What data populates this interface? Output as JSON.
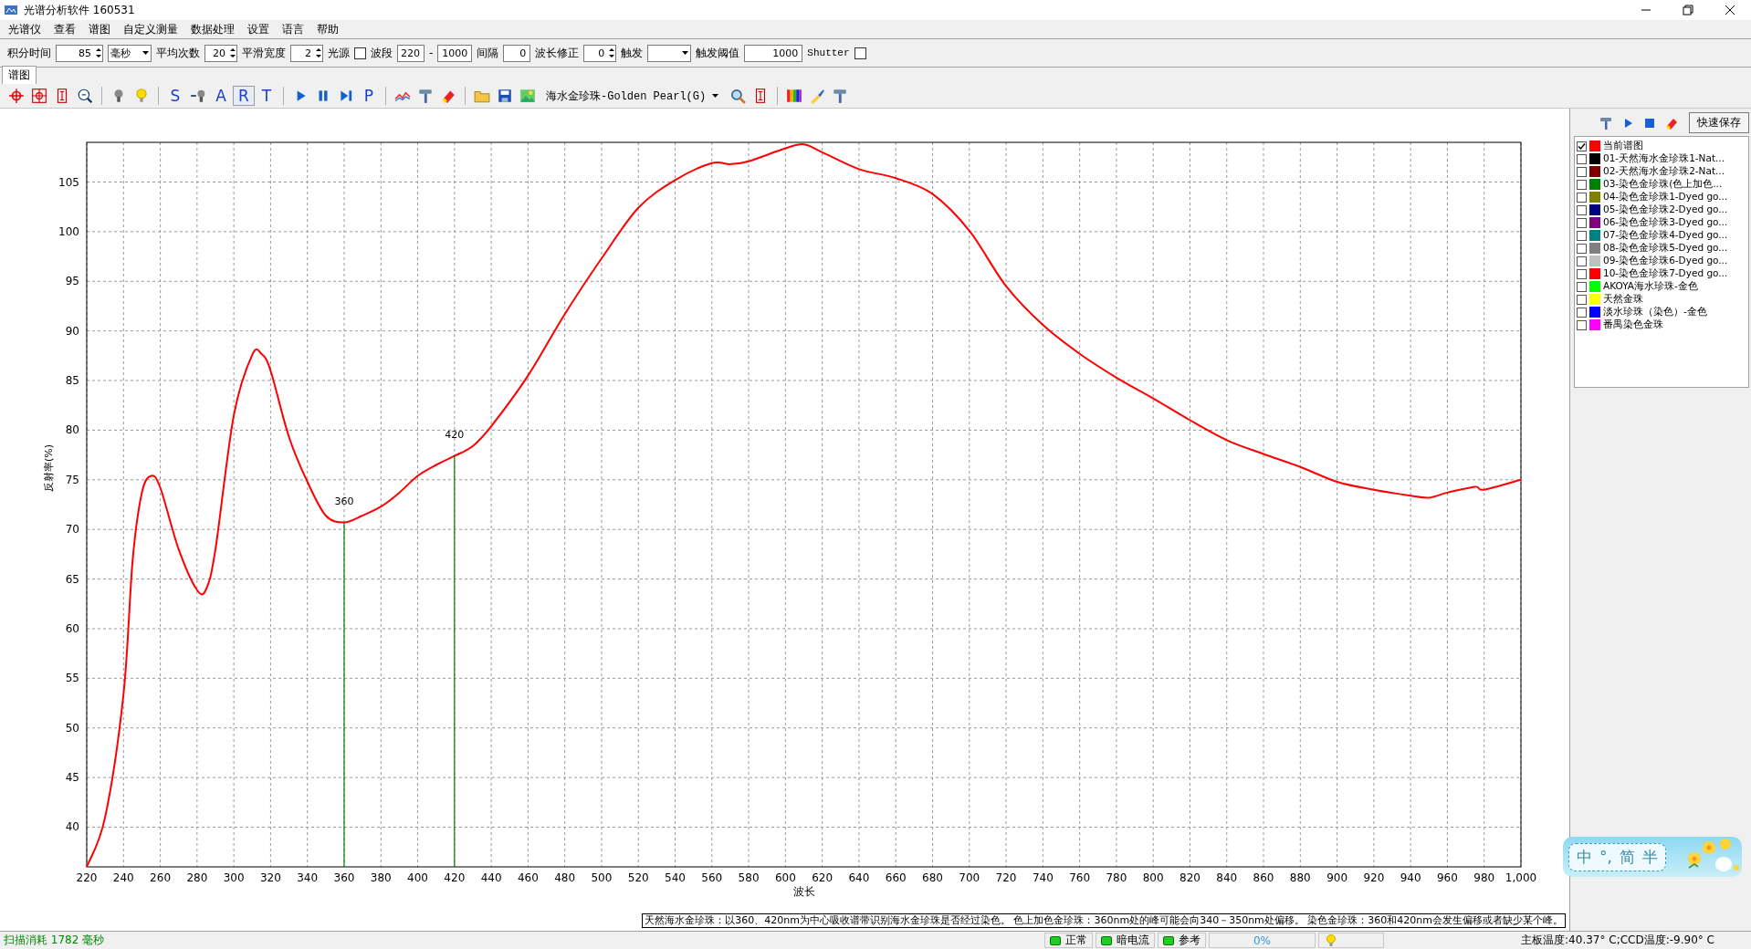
{
  "window": {
    "title": "光谱分析软件 160531"
  },
  "menu": [
    "光谱仪",
    "查看",
    "谱图",
    "自定义测量",
    "数据处理",
    "设置",
    "语言",
    "帮助"
  ],
  "params": [
    {
      "kind": "label",
      "text": "积分时间"
    },
    {
      "kind": "spin",
      "value": "85"
    },
    {
      "kind": "select",
      "value": "毫秒"
    },
    {
      "kind": "label",
      "text": "平均次数"
    },
    {
      "kind": "spin",
      "value": "20"
    },
    {
      "kind": "label",
      "text": "平滑宽度"
    },
    {
      "kind": "spin",
      "value": "2"
    },
    {
      "kind": "label",
      "text": "光源"
    },
    {
      "kind": "checkbox",
      "checked": false
    },
    {
      "kind": "label",
      "text": "波段"
    },
    {
      "kind": "field",
      "value": "220"
    },
    {
      "kind": "label",
      "text": "-"
    },
    {
      "kind": "field",
      "value": "1000"
    },
    {
      "kind": "label",
      "text": "间隔"
    },
    {
      "kind": "field",
      "value": "0"
    },
    {
      "kind": "label",
      "text": "波长修正"
    },
    {
      "kind": "spin",
      "value": "0"
    },
    {
      "kind": "label",
      "text": "触发"
    },
    {
      "kind": "select"
    },
    {
      "kind": "label",
      "text": "触发阈值"
    },
    {
      "kind": "wide",
      "value": "1000"
    },
    {
      "kind": "label",
      "text": "Shutter"
    },
    {
      "kind": "checkbox",
      "checked": false
    }
  ],
  "tabs": [
    {
      "label": "谱图",
      "selected": true
    }
  ],
  "toolbar": {
    "letters": [
      {
        "text": "S",
        "selected": false
      },
      {
        "text": "A",
        "selected": false
      },
      {
        "text": "R",
        "selected": true
      },
      {
        "text": "T",
        "selected": false
      },
      {
        "text": "P",
        "selected": false
      }
    ],
    "spectrum_select": "海水金珍珠-Golden Pearl(G)"
  },
  "chart_data": {
    "type": "line",
    "xlabel": "波长",
    "ylabel": "反射率(%)",
    "x": [
      220,
      230,
      240,
      245,
      250,
      255,
      260,
      270,
      280,
      285,
      290,
      300,
      310,
      315,
      320,
      330,
      340,
      350,
      360,
      370,
      380,
      390,
      400,
      410,
      420,
      430,
      440,
      460,
      480,
      500,
      520,
      540,
      560,
      570,
      580,
      600,
      610,
      620,
      640,
      660,
      680,
      700,
      720,
      740,
      760,
      780,
      800,
      820,
      840,
      860,
      880,
      900,
      920,
      940,
      950,
      960,
      975,
      980,
      1000
    ],
    "series": [
      {
        "color": "#ff0000",
        "values": [
          36,
          41,
          53.4,
          67,
          73.7,
          75.4,
          74.2,
          68,
          63.9,
          64,
          68,
          81.5,
          87.6,
          87.7,
          86,
          79.3,
          74.8,
          71.4,
          70.7,
          71.4,
          72.3,
          73.7,
          75.4,
          76.5,
          77.4,
          78.4,
          80.4,
          85.5,
          91.7,
          97.3,
          102.4,
          105.2,
          106.9,
          106.8,
          107.1,
          108.4,
          108.8,
          108,
          106.3,
          105.4,
          103.8,
          100.1,
          94.5,
          90.6,
          87.7,
          85.3,
          83.2,
          81,
          79,
          77.6,
          76.3,
          74.8,
          74,
          73.4,
          73.2,
          73.7,
          74.3,
          74,
          75
        ]
      }
    ],
    "xlim": [
      220,
      1000
    ],
    "ylim": [
      36,
      109
    ],
    "xticks": [
      220,
      240,
      260,
      280,
      300,
      320,
      340,
      360,
      380,
      400,
      420,
      440,
      460,
      480,
      500,
      520,
      540,
      560,
      580,
      600,
      620,
      640,
      660,
      680,
      700,
      720,
      740,
      760,
      780,
      800,
      820,
      840,
      860,
      880,
      900,
      920,
      940,
      960,
      980,
      {
        "value": 1000,
        "label": "1,000"
      }
    ],
    "yticks": [
      40,
      45,
      50,
      55,
      60,
      65,
      70,
      75,
      80,
      85,
      90,
      95,
      100,
      105
    ],
    "grid": true,
    "ref_lines": [
      {
        "axis": "x",
        "value": 360,
        "label": "360",
        "color": "#008000"
      },
      {
        "axis": "x",
        "value": 420,
        "label": "420",
        "color": "#008000"
      }
    ]
  },
  "side_panel": {
    "save_button": "快速保存",
    "legend": [
      {
        "label": "当前谱图",
        "checked": true,
        "color": "#ff0000"
      },
      {
        "label": "01-天然海水金珍珠1-Nat...",
        "checked": false,
        "color": "#000000"
      },
      {
        "label": "02-天然海水金珍珠2-Nat...",
        "checked": false,
        "color": "#800000"
      },
      {
        "label": "03-染色金珍珠(色上加色...",
        "checked": false,
        "color": "#008000"
      },
      {
        "label": "04-染色金珍珠1-Dyed go...",
        "checked": false,
        "color": "#808000"
      },
      {
        "label": "05-染色金珍珠2-Dyed go...",
        "checked": false,
        "color": "#000080"
      },
      {
        "label": "06-染色金珍珠3-Dyed go...",
        "checked": false,
        "color": "#800080"
      },
      {
        "label": "07-染色金珍珠4-Dyed go...",
        "checked": false,
        "color": "#008080"
      },
      {
        "label": "08-染色金珍珠5-Dyed go...",
        "checked": false,
        "color": "#808080"
      },
      {
        "label": "09-染色金珍珠6-Dyed go...",
        "checked": false,
        "color": "#c0c0c0"
      },
      {
        "label": "10-染色金珍珠7-Dyed go...",
        "checked": false,
        "color": "#ff0000"
      },
      {
        "label": "AKOYA海水珍珠-金色",
        "checked": false,
        "color": "#00ff00"
      },
      {
        "label": "天然金珠",
        "checked": false,
        "color": "#ffff00"
      },
      {
        "label": "淡水珍珠（染色）-金色",
        "checked": false,
        "color": "#0000ff"
      },
      {
        "label": "番禺染色金珠",
        "checked": false,
        "color": "#ff00ff"
      }
    ]
  },
  "note": "天然海水金珍珠：以360、420nm为中心吸收谱带识别海水金珍珠是否经过染色。 色上加色金珍珠：360nm处的峰可能会向340－350nm处偏移。 染色金珍珠：360和420nm会发生偏移或者缺少某个峰。",
  "status_bar": {
    "scan_time": "扫描消耗 1782 毫秒",
    "indicators": [
      {
        "label": "正常"
      },
      {
        "label": "暗电流"
      },
      {
        "label": "参考"
      }
    ],
    "progress": {
      "level": 0,
      "text": "0%"
    },
    "temperature": "主板温度:40.37° C;CCD温度:-9.90° C"
  },
  "ime": {
    "items": [
      "中",
      "°,",
      "简",
      "半"
    ]
  }
}
